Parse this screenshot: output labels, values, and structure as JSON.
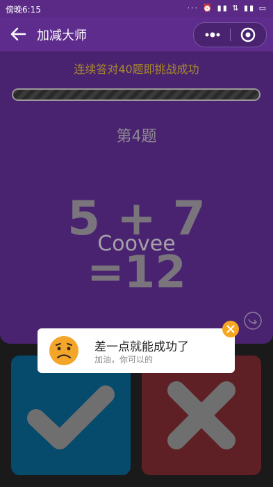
{
  "status_bar": {
    "time": "傍晚6:15",
    "icons": "··· ⏰ ▮▮ ⇅ ▮▮ ▭"
  },
  "nav": {
    "title": "加减大师"
  },
  "game": {
    "challenge_text": "连续答对40题即挑战成功",
    "question_label": "第4题",
    "equation_line1": "5 + 7",
    "equation_line2": "=12",
    "watermark": "Coovee"
  },
  "toast": {
    "message": "差一点就能成功了",
    "subtext": "加油，你可以的"
  },
  "colors": {
    "nav_bg": "#5e2c8c",
    "game_bg": "#4a2370",
    "subtitle": "#a88a2a",
    "correct_button": "#064a6c",
    "wrong_button": "#5e2024",
    "toast_close": "#f5a623"
  },
  "icons": {
    "back": "arrow-left-icon",
    "more": "more-dots-icon",
    "close": "target-circle-icon",
    "share": "share-icon",
    "correct": "checkmark-icon",
    "wrong": "x-mark-icon",
    "face": "worried-face-icon",
    "toast_close": "close-icon"
  }
}
